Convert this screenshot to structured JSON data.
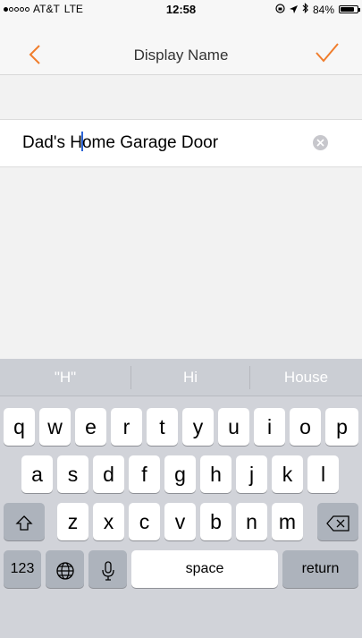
{
  "status_bar": {
    "carrier": "AT&T",
    "network": "LTE",
    "time": "12:58",
    "battery_text": "84%",
    "battery_level": 0.84,
    "signal_filled": 1,
    "signal_total": 5
  },
  "nav": {
    "title": "Display Name",
    "accent_color": "#f07d2c"
  },
  "field": {
    "value_before_caret": "Dad's H",
    "value_after_caret": "ome Garage Door"
  },
  "keyboard": {
    "suggestions": [
      "\"H\"",
      "Hi",
      "House"
    ],
    "row1": [
      "q",
      "w",
      "e",
      "r",
      "t",
      "y",
      "u",
      "i",
      "o",
      "p"
    ],
    "row2": [
      "a",
      "s",
      "d",
      "f",
      "g",
      "h",
      "j",
      "k",
      "l"
    ],
    "row3": [
      "z",
      "x",
      "c",
      "v",
      "b",
      "n",
      "m"
    ],
    "numbers_label": "123",
    "space_label": "space",
    "return_label": "return"
  }
}
